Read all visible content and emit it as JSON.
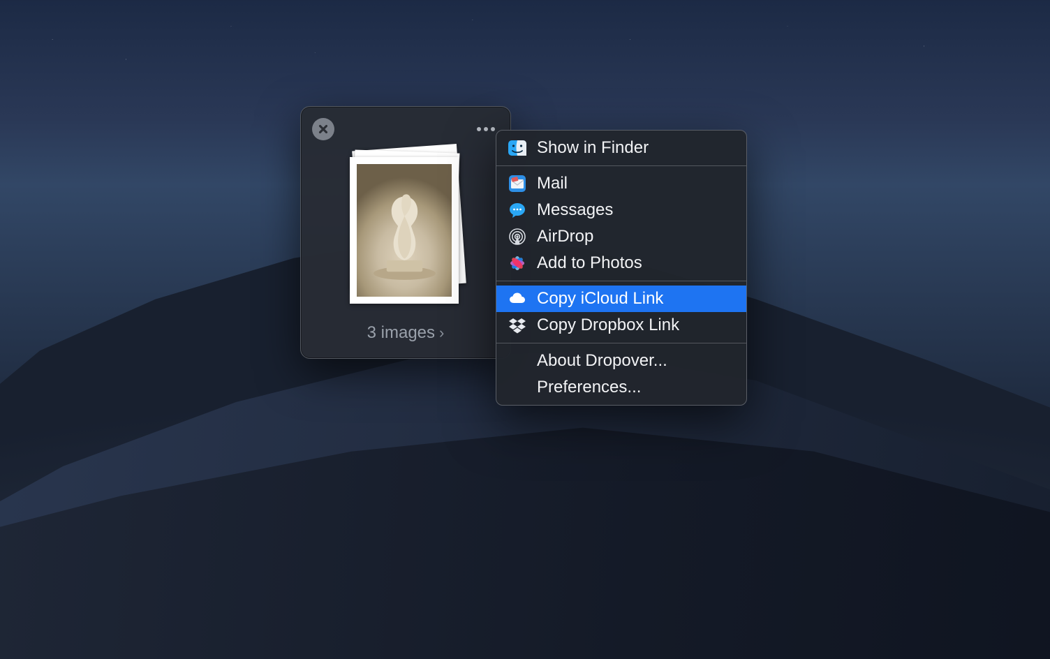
{
  "shelf": {
    "caption": "3 images"
  },
  "menu": {
    "groups": [
      [
        {
          "icon": "finder-icon",
          "label": "Show in Finder"
        }
      ],
      [
        {
          "icon": "mail-icon",
          "label": "Mail"
        },
        {
          "icon": "messages-icon",
          "label": "Messages"
        },
        {
          "icon": "airdrop-icon",
          "label": "AirDrop"
        },
        {
          "icon": "photos-icon",
          "label": "Add to Photos"
        }
      ],
      [
        {
          "icon": "cloud-icon",
          "label": "Copy iCloud Link",
          "selected": true
        },
        {
          "icon": "dropbox-icon",
          "label": "Copy Dropbox Link"
        }
      ],
      [
        {
          "icon": null,
          "label": "About Dropover..."
        },
        {
          "icon": null,
          "label": "Preferences..."
        }
      ]
    ]
  }
}
